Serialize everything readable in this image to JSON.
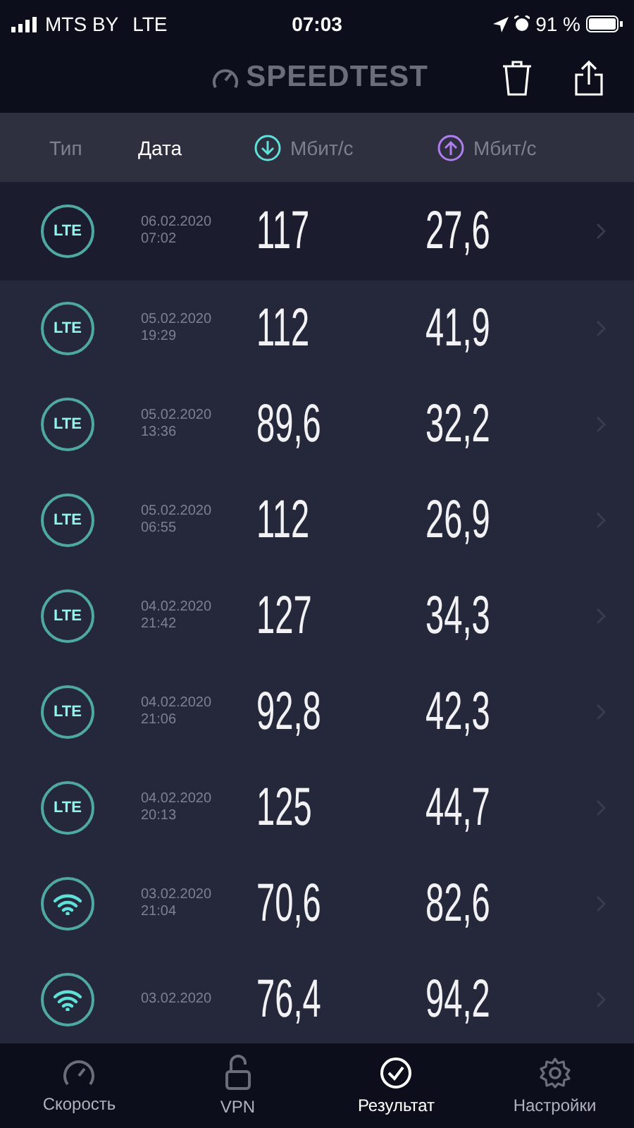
{
  "status_bar": {
    "carrier": "MTS BY",
    "network": "LTE",
    "time": "07:03",
    "battery": "91 %"
  },
  "header": {
    "logo": "SPEEDTEST"
  },
  "columns": [
    {
      "label": "Тип",
      "selected": false,
      "kind": "text"
    },
    {
      "label": "Дата",
      "selected": true,
      "kind": "text"
    },
    {
      "label": "Мбит/с",
      "selected": false,
      "kind": "download"
    },
    {
      "label": "Мбит/с",
      "selected": false,
      "kind": "upload"
    }
  ],
  "rows": [
    {
      "kind": "lte",
      "type_label": "LTE",
      "date": "06.02.2020",
      "time": "07:02",
      "download": "117",
      "upload": "27,6",
      "selected": true
    },
    {
      "kind": "lte",
      "type_label": "LTE",
      "date": "05.02.2020",
      "time": "19:29",
      "download": "112",
      "upload": "41,9",
      "selected": false
    },
    {
      "kind": "lte",
      "type_label": "LTE",
      "date": "05.02.2020",
      "time": "13:36",
      "download": "89,6",
      "upload": "32,2",
      "selected": false
    },
    {
      "kind": "lte",
      "type_label": "LTE",
      "date": "05.02.2020",
      "time": "06:55",
      "download": "112",
      "upload": "26,9",
      "selected": false
    },
    {
      "kind": "lte",
      "type_label": "LTE",
      "date": "04.02.2020",
      "time": "21:42",
      "download": "127",
      "upload": "34,3",
      "selected": false
    },
    {
      "kind": "lte",
      "type_label": "LTE",
      "date": "04.02.2020",
      "time": "21:06",
      "download": "92,8",
      "upload": "42,3",
      "selected": false
    },
    {
      "kind": "lte",
      "type_label": "LTE",
      "date": "04.02.2020",
      "time": "20:13",
      "download": "125",
      "upload": "44,7",
      "selected": false
    },
    {
      "kind": "wifi",
      "date": "03.02.2020",
      "time": "21:04",
      "download": "70,6",
      "upload": "82,6",
      "selected": false
    },
    {
      "kind": "wifi",
      "date": "03.02.2020",
      "download": "76,4",
      "upload": "94,2",
      "selected": false
    }
  ],
  "tabs": [
    {
      "label": "Скорость",
      "kind": "gauge",
      "selected": false
    },
    {
      "label": "VPN",
      "kind": "lock",
      "selected": false
    },
    {
      "label": "Результат",
      "kind": "check",
      "selected": true
    },
    {
      "label": "Настройки",
      "kind": "gear",
      "selected": false
    }
  ]
}
